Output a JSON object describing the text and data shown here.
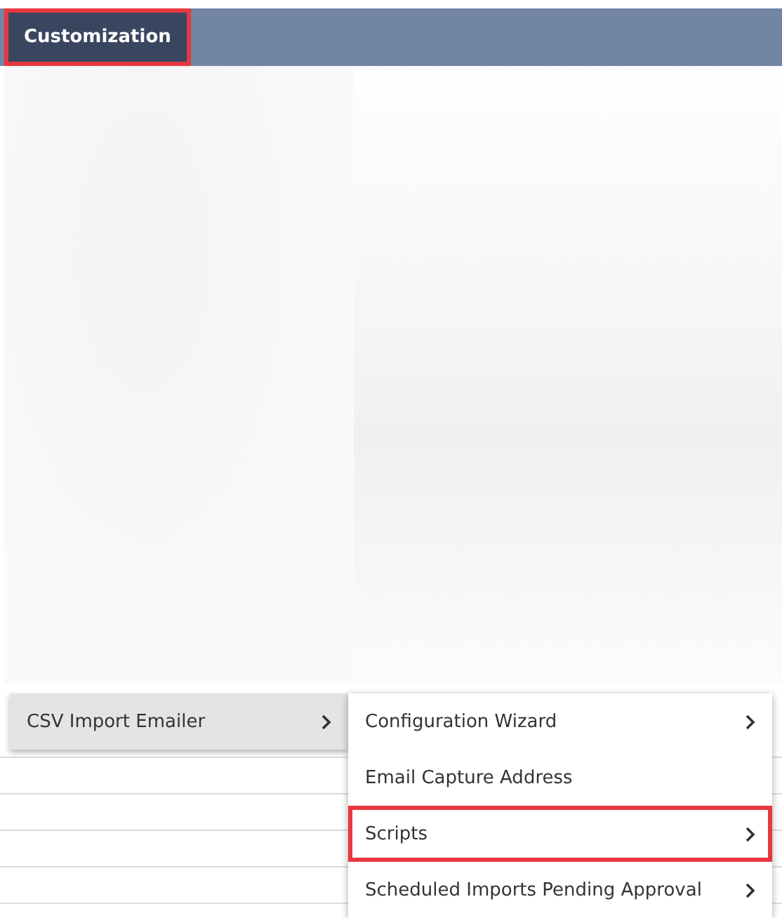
{
  "menubar": {
    "tabs": [
      {
        "label": "Customization",
        "selected": true,
        "highlighted": true
      }
    ]
  },
  "menu": {
    "items": [
      {
        "label": "CSV Import Emailer",
        "selected": true,
        "has_submenu": true
      }
    ]
  },
  "submenu": {
    "items": [
      {
        "label": "Configuration Wizard",
        "has_submenu": true,
        "highlighted": false
      },
      {
        "label": "Email Capture Address",
        "has_submenu": false,
        "highlighted": false
      },
      {
        "label": "Scripts",
        "has_submenu": true,
        "highlighted": true
      },
      {
        "label": "Scheduled Imports Pending Approval",
        "has_submenu": true,
        "highlighted": false
      }
    ]
  }
}
